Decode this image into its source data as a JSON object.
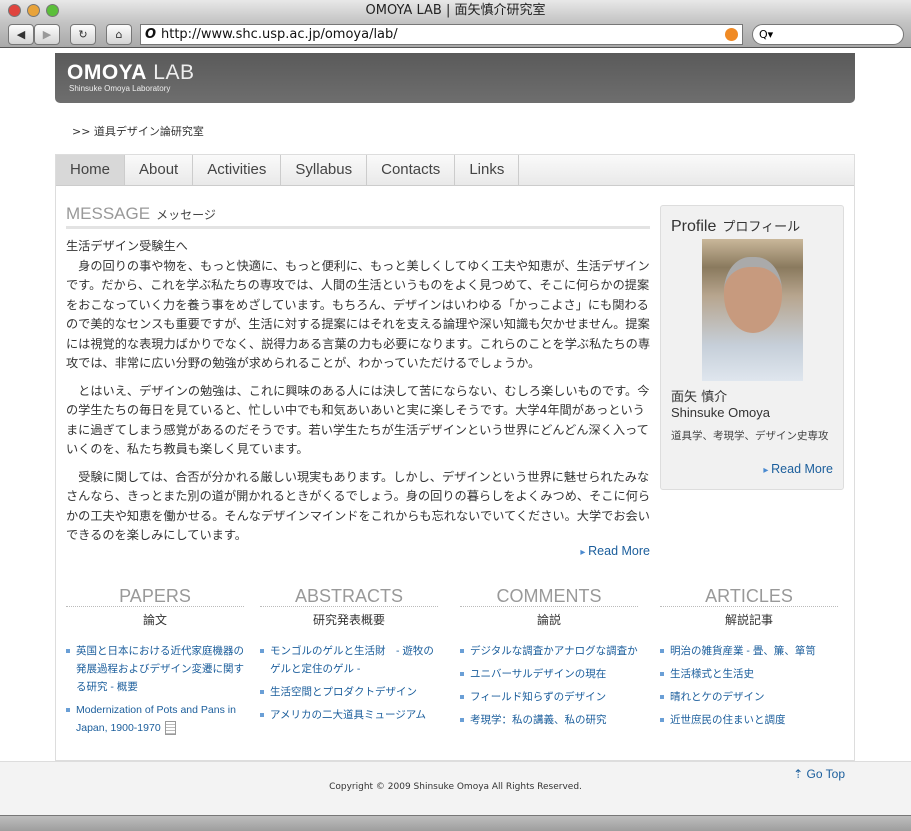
{
  "browser": {
    "title": "OMOYA LAB | 面矢慎介研究室",
    "url": "http://www.shc.usp.ac.jp/omoya/lab/",
    "search_placeholder": "Q▾"
  },
  "header": {
    "logo_bold": "OMOYA",
    "logo_thin": "LAB",
    "subtitle": "Shinsuke Omoya Laboratory"
  },
  "breadcrumb": ">> 道具デザイン論研究室",
  "nav": [
    "Home",
    "About",
    "Activities",
    "Syllabus",
    "Contacts",
    "Links"
  ],
  "message": {
    "title_en": "MESSAGE",
    "title_ja": "メッセージ",
    "paragraphs": [
      "生活デザイン受験生へ\n　身の回りの事や物を、もっと快適に、もっと便利に、もっと美しくしてゆく工夫や知恵が、生活デザインです。だから、これを学ぶ私たちの専攻では、人間の生活というものをよく見つめて、そこに何らかの提案をおこなっていく力を養う事をめざしています。もちろん、デザインはいわゆる「かっこよさ」にも関わるので美的なセンスも重要ですが、生活に対する提案にはそれを支える論理や深い知識も欠かせません。提案には視覚的な表現力ばかりでなく、説得力ある言葉の力も必要になります。これらのことを学ぶ私たちの専攻では、非常に広い分野の勉強が求められることが、わかっていただけるでしょうか。",
      "　とはいえ、デザインの勉強は、これに興味のある人には決して苦にならない、むしろ楽しいものです。今の学生たちの毎日を見ていると、忙しい中でも和気あいあいと実に楽しそうです。大学4年間があっというまに過ぎてしまう感覚があるのだそうです。若い学生たちが生活デザインという世界にどんどん深く入っていくのを、私たち教員も楽しく見ています。",
      "　受験に関しては、合否が分かれる厳しい現実もあります。しかし、デザインという世界に魅せられたみなさんなら、きっとまた別の道が開かれるときがくるでしょう。身の回りの暮らしをよくみつめ、そこに何らかの工夫や知恵を働かせる。そんなデザインマインドをこれからも忘れないでいてください。大学でお会いできるのを楽しみにしています。"
    ],
    "read_more": "Read More"
  },
  "profile": {
    "title_en": "Profile",
    "title_ja": "プロフィール",
    "name_ja": "面矢 慎介",
    "name_en": "Shinsuke Omoya",
    "desc": "道具学、考現学、デザイン史専攻",
    "read_more": "Read More"
  },
  "columns": [
    {
      "title": "PAPERS",
      "subtitle": "論文",
      "items": [
        "英国と日本における近代家庭機器の発展過程およびデザイン変遷に関する研究 - 概要",
        "Modernization of Pots and Pans in Japan, 1900-1970"
      ]
    },
    {
      "title": "ABSTRACTS",
      "subtitle": "研究発表概要",
      "items": [
        "モンゴルのゲルと生活財　- 遊牧のゲルと定住のゲル -",
        "生活空間とプロダクトデザイン",
        "アメリカの二大道具ミュージアム"
      ]
    },
    {
      "title": "COMMENTS",
      "subtitle": "論説",
      "items": [
        "デジタルな調査かアナログな調査か",
        "ユニバーサルデザインの現在",
        "フィールド知らずのデザイン",
        "考現学：私の講義、私の研究"
      ]
    },
    {
      "title": "ARTICLES",
      "subtitle": "解説記事",
      "items": [
        "明治の雑貨産業 - 畳、簾、箪笥",
        "生活様式と生活史",
        "晴れとケのデザイン",
        "近世庶民の住まいと調度"
      ]
    }
  ],
  "footer": {
    "go_top": "Go Top",
    "copyright": "Copyright © 2009 Shinsuke Omoya All Rights Reserved."
  }
}
